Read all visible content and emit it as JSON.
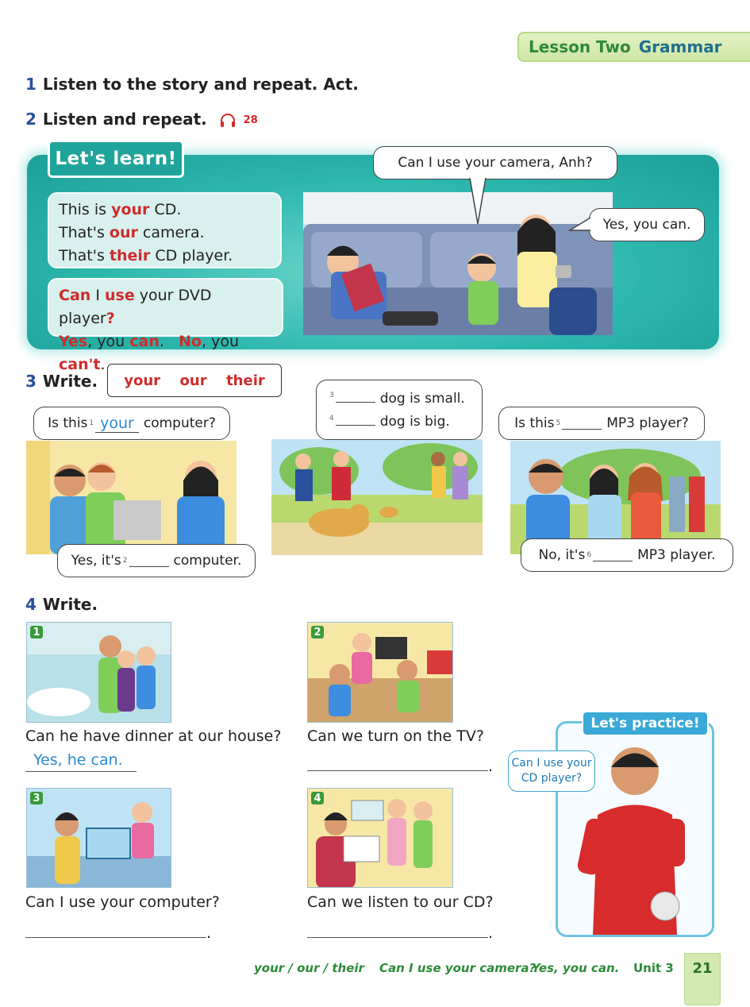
{
  "header": {
    "lesson": "Lesson Two",
    "topic": "Grammar"
  },
  "ex1": {
    "num": "1",
    "title": "Listen to the story and repeat. Act."
  },
  "ex2": {
    "num": "2",
    "title": "Listen and repeat.",
    "track": "28"
  },
  "learn": {
    "badge": "Let's learn!",
    "box1": [
      {
        "pre": "This is ",
        "key": "your",
        "post": " CD."
      },
      {
        "pre": "That's ",
        "key": "our",
        "post": " camera."
      },
      {
        "pre": "That's ",
        "key": "their",
        "post": " CD player."
      }
    ],
    "box2": {
      "q_can": "Can",
      "q_i": " I ",
      "q_use": "use",
      "q_rest": " your DVD player",
      "q_mark": "?",
      "yes": "Yes",
      "yes_mid": ", you ",
      "yes_can": "can",
      "yes_end": ".",
      "no": "No",
      "no_mid": ", you ",
      "no_cant": "can't",
      "no_end": "."
    },
    "bubble_q": "Can I use your camera, Anh?",
    "bubble_a": "Yes, you can."
  },
  "ex3": {
    "num": "3",
    "title": "Write.",
    "words": [
      "your",
      "our",
      "their"
    ],
    "s1": {
      "pre": "Is this",
      "n": "1",
      "answer": "your",
      "post": "computer?"
    },
    "s2": {
      "pre": "Yes, it's",
      "n": "2",
      "post": "computer."
    },
    "s3": {
      "n": "3",
      "post": "dog is small."
    },
    "s4": {
      "n": "4",
      "post": "dog is big."
    },
    "s5": {
      "pre": "Is this",
      "n": "5",
      "post": "MP3 player?"
    },
    "s6": {
      "pre": "No, it's",
      "n": "6",
      "post": "MP3 player."
    }
  },
  "ex4": {
    "num": "4",
    "title": "Write.",
    "items": [
      {
        "n": "1",
        "q": "Can he have dinner at our house?",
        "a": "Yes, he can."
      },
      {
        "n": "2",
        "q": "Can we turn on the TV?",
        "a": "."
      },
      {
        "n": "3",
        "q": "Can I use your computer?",
        "a": "."
      },
      {
        "n": "4",
        "q": "Can we listen to our CD?",
        "a": "."
      }
    ]
  },
  "practice": {
    "badge": "Let's practice!",
    "bubble_l1": "Can I use your",
    "bubble_l2": "CD player?"
  },
  "footer": {
    "f1": "your / our / their",
    "f2": "Can I use your camera?",
    "f3": "Yes, you can.",
    "unit": "Unit 3",
    "page": "21"
  },
  "colors": {
    "accent_red": "#cf2b2b",
    "teal": "#2cb7ad",
    "navy": "#2a4f9c",
    "green": "#2e8a3a",
    "answer_blue": "#2a8ad1"
  }
}
